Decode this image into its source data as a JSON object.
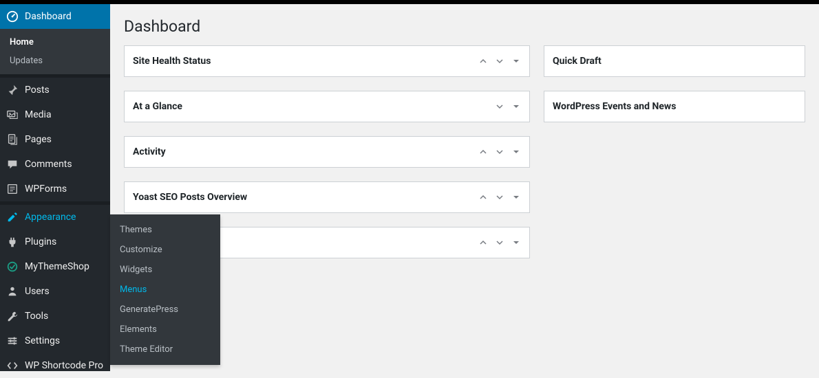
{
  "page": {
    "title": "Dashboard"
  },
  "sidebar": {
    "items": [
      {
        "label": "Dashboard",
        "icon": "dashboard"
      },
      {
        "label": "Posts",
        "icon": "pin"
      },
      {
        "label": "Media",
        "icon": "media"
      },
      {
        "label": "Pages",
        "icon": "pages"
      },
      {
        "label": "Comments",
        "icon": "comments"
      },
      {
        "label": "WPForms",
        "icon": "wpforms"
      },
      {
        "label": "Appearance",
        "icon": "appearance"
      },
      {
        "label": "Plugins",
        "icon": "plugins"
      },
      {
        "label": "MyThemeShop",
        "icon": "mts"
      },
      {
        "label": "Users",
        "icon": "users"
      },
      {
        "label": "Tools",
        "icon": "tools"
      },
      {
        "label": "Settings",
        "icon": "settings"
      },
      {
        "label": "WP Shortcode Pro",
        "icon": "shortcode"
      }
    ],
    "dashboard_submenu": [
      {
        "label": "Home"
      },
      {
        "label": "Updates"
      }
    ]
  },
  "appearance_flyout": [
    {
      "label": "Themes"
    },
    {
      "label": "Customize"
    },
    {
      "label": "Widgets"
    },
    {
      "label": "Menus"
    },
    {
      "label": "GeneratePress"
    },
    {
      "label": "Elements"
    },
    {
      "label": "Theme Editor"
    }
  ],
  "left_boxes": [
    {
      "title": "Site Health Status"
    },
    {
      "title": "At a Glance"
    },
    {
      "title": "Activity"
    },
    {
      "title": "Yoast SEO Posts Overview"
    },
    {
      "title": ""
    }
  ],
  "right_boxes": [
    {
      "title": "Quick Draft"
    },
    {
      "title": "WordPress Events and News"
    }
  ]
}
